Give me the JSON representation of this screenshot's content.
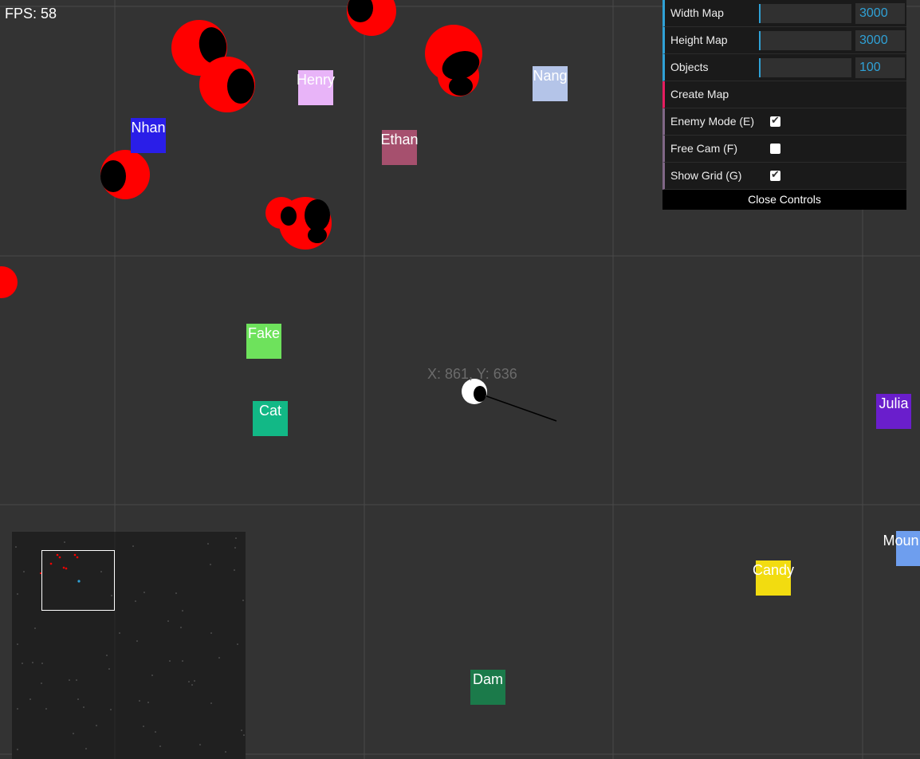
{
  "hud": {
    "fps": "FPS: 58",
    "player_coords": "X: 861, Y: 636"
  },
  "named_objects": [
    {
      "label": "Henry",
      "color": "#e8b4f8"
    },
    {
      "label": "Nang",
      "color": "#b4c4e8"
    },
    {
      "label": "Nhan",
      "color": "#2a1ee8"
    },
    {
      "label": "Ethan",
      "color": "#a6506e"
    },
    {
      "label": "Fake",
      "color": "#6ee25c"
    },
    {
      "label": "Cat",
      "color": "#12b886"
    },
    {
      "label": "Julia",
      "color": "#6a1ecc"
    },
    {
      "label": "Candy",
      "color": "#f2dc10"
    },
    {
      "label": "Moun",
      "color": "#6e9eee"
    },
    {
      "label": "Dam",
      "color": "#1b7a4a"
    }
  ],
  "controls": {
    "width_map": {
      "label": "Width Map",
      "value": "3000"
    },
    "height_map": {
      "label": "Height Map",
      "value": "3000"
    },
    "objects": {
      "label": "Objects",
      "value": "100"
    },
    "create_map": {
      "label": "Create Map"
    },
    "enemy_mode": {
      "label": "Enemy Mode (E)",
      "checked": true
    },
    "free_cam": {
      "label": "Free Cam (F)",
      "checked": false
    },
    "show_grid": {
      "label": "Show Grid (G)",
      "checked": true
    },
    "close_label": "Close Controls"
  },
  "colors": {
    "enemy": "#ff0000",
    "player": "#ffffff",
    "grid": "#4a4a4a",
    "accent": "#2fa1d6"
  }
}
